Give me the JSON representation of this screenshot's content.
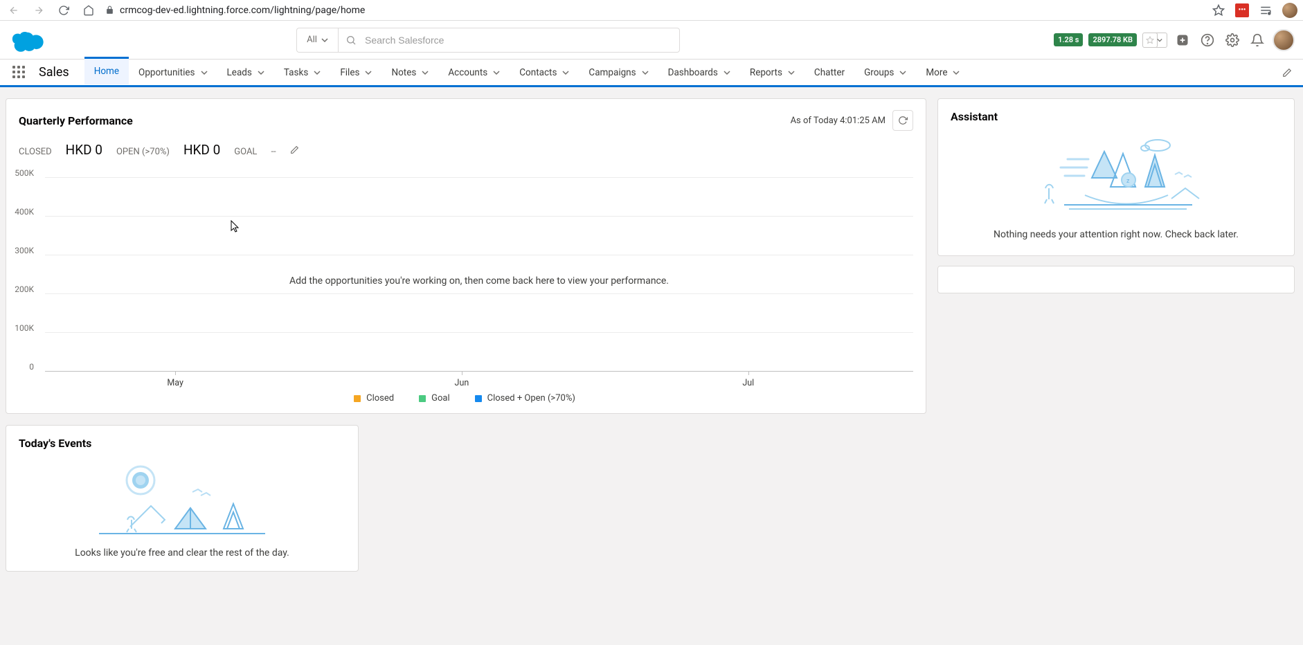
{
  "browser": {
    "url": "crmcog-dev-ed.lightning.force.com/lightning/page/home"
  },
  "header": {
    "search_scope": "All",
    "search_placeholder": "Search Salesforce",
    "perf_time": "1.28 s",
    "perf_size": "2897.78 KB"
  },
  "nav": {
    "app_name": "Sales",
    "items": [
      {
        "label": "Home",
        "active": true,
        "dropdown": false
      },
      {
        "label": "Opportunities",
        "active": false,
        "dropdown": true
      },
      {
        "label": "Leads",
        "active": false,
        "dropdown": true
      },
      {
        "label": "Tasks",
        "active": false,
        "dropdown": true
      },
      {
        "label": "Files",
        "active": false,
        "dropdown": true
      },
      {
        "label": "Notes",
        "active": false,
        "dropdown": true
      },
      {
        "label": "Accounts",
        "active": false,
        "dropdown": true
      },
      {
        "label": "Contacts",
        "active": false,
        "dropdown": true
      },
      {
        "label": "Campaigns",
        "active": false,
        "dropdown": true
      },
      {
        "label": "Dashboards",
        "active": false,
        "dropdown": true
      },
      {
        "label": "Reports",
        "active": false,
        "dropdown": true
      },
      {
        "label": "Chatter",
        "active": false,
        "dropdown": false
      },
      {
        "label": "Groups",
        "active": false,
        "dropdown": true
      },
      {
        "label": "More",
        "active": false,
        "dropdown": true
      }
    ]
  },
  "qp": {
    "title": "Quarterly Performance",
    "as_of": "As of Today 4:01:25 AM",
    "closed_label": "CLOSED",
    "closed_value": "HKD 0",
    "open_label": "OPEN (>70%)",
    "open_value": "HKD 0",
    "goal_label": "GOAL",
    "goal_value": "--",
    "empty_msg": "Add the opportunities you're working on, then come back here to view your performance.",
    "legend": {
      "closed": "Closed",
      "goal": "Goal",
      "closed_open": "Closed + Open (>70%)"
    }
  },
  "events": {
    "title": "Today's Events",
    "msg": "Looks like you're free and clear the rest of the day."
  },
  "assistant": {
    "title": "Assistant",
    "msg": "Nothing needs your attention right now. Check back later."
  },
  "colors": {
    "closed": "#f5a623",
    "goal": "#4bca81",
    "closed_open": "#1589ee"
  },
  "chart_data": {
    "type": "line",
    "title": "Quarterly Performance",
    "xlabel": "",
    "ylabel": "",
    "ylim": [
      0,
      500000
    ],
    "y_ticks": [
      "0",
      "100K",
      "200K",
      "300K",
      "400K",
      "500K"
    ],
    "categories": [
      "May",
      "Jun",
      "Jul"
    ],
    "series": [
      {
        "name": "Closed",
        "values": [
          0,
          0,
          0
        ],
        "color": "#f5a623"
      },
      {
        "name": "Goal",
        "values": [
          null,
          null,
          null
        ],
        "color": "#4bca81"
      },
      {
        "name": "Closed + Open (>70%)",
        "values": [
          0,
          0,
          0
        ],
        "color": "#1589ee"
      }
    ]
  }
}
